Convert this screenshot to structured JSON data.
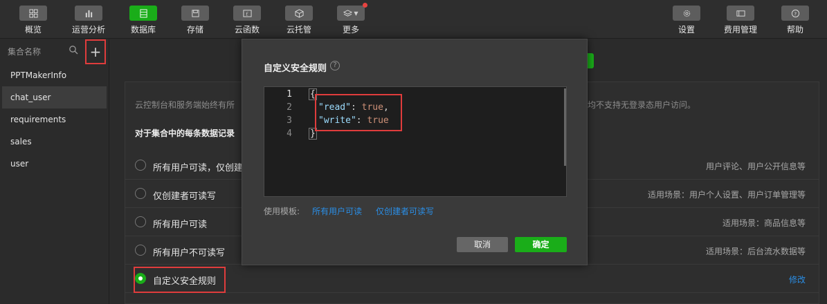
{
  "toolbar": {
    "left": [
      {
        "label": "概览",
        "icon": "grid-icon"
      },
      {
        "label": "运营分析",
        "icon": "bar-chart-icon"
      },
      {
        "label": "数据库",
        "icon": "database-icon",
        "active": true
      },
      {
        "label": "存储",
        "icon": "save-icon"
      },
      {
        "label": "云函数",
        "icon": "function-icon"
      },
      {
        "label": "云托管",
        "icon": "cube-icon"
      },
      {
        "label": "更多",
        "icon": "layers-icon"
      }
    ],
    "right": [
      {
        "label": "设置",
        "icon": "gear-icon"
      },
      {
        "label": "费用管理",
        "icon": "billing-icon"
      },
      {
        "label": "帮助",
        "icon": "help-icon"
      }
    ]
  },
  "sidebar": {
    "title": "集合名称",
    "add_label": "+",
    "collections": [
      "PPTMakerInfo",
      "chat_user",
      "requirements",
      "sales",
      "user"
    ],
    "selected": "chat_user"
  },
  "main": {
    "description_left": "云控制台和服务端始终有所",
    "description_right": "均不支持无登录态用户访问。",
    "section_title": "对于集合中的每条数据记录",
    "options": [
      {
        "label": "所有用户可读，仅创建",
        "hint": "用户评论、用户公开信息等"
      },
      {
        "label": "仅创建者可读写",
        "hint": "适用场景：用户个人设置、用户订单管理等"
      },
      {
        "label": "所有用户可读",
        "hint": "适用场景：商品信息等"
      },
      {
        "label": "所有用户不可读写",
        "hint": "适用场景：后台流水数据等"
      },
      {
        "label": "自定义安全规则",
        "link": "修改",
        "selected": true
      }
    ]
  },
  "modal": {
    "title": "自定义安全规则",
    "help": "?",
    "line_numbers": [
      "1",
      "2",
      "3",
      "4"
    ],
    "code": {
      "open": "{",
      "read_key": "\"read\"",
      "read_val": "true",
      "write_key": "\"write\"",
      "write_val": "true",
      "close": "}"
    },
    "template_label": "使用模板:",
    "templates": [
      "所有用户可读",
      "仅创建者可读写"
    ],
    "cancel": "取消",
    "confirm": "确定"
  },
  "colors": {
    "accent": "#1aad19",
    "link": "#2a8ee6",
    "highlight": "#e03c3c"
  }
}
